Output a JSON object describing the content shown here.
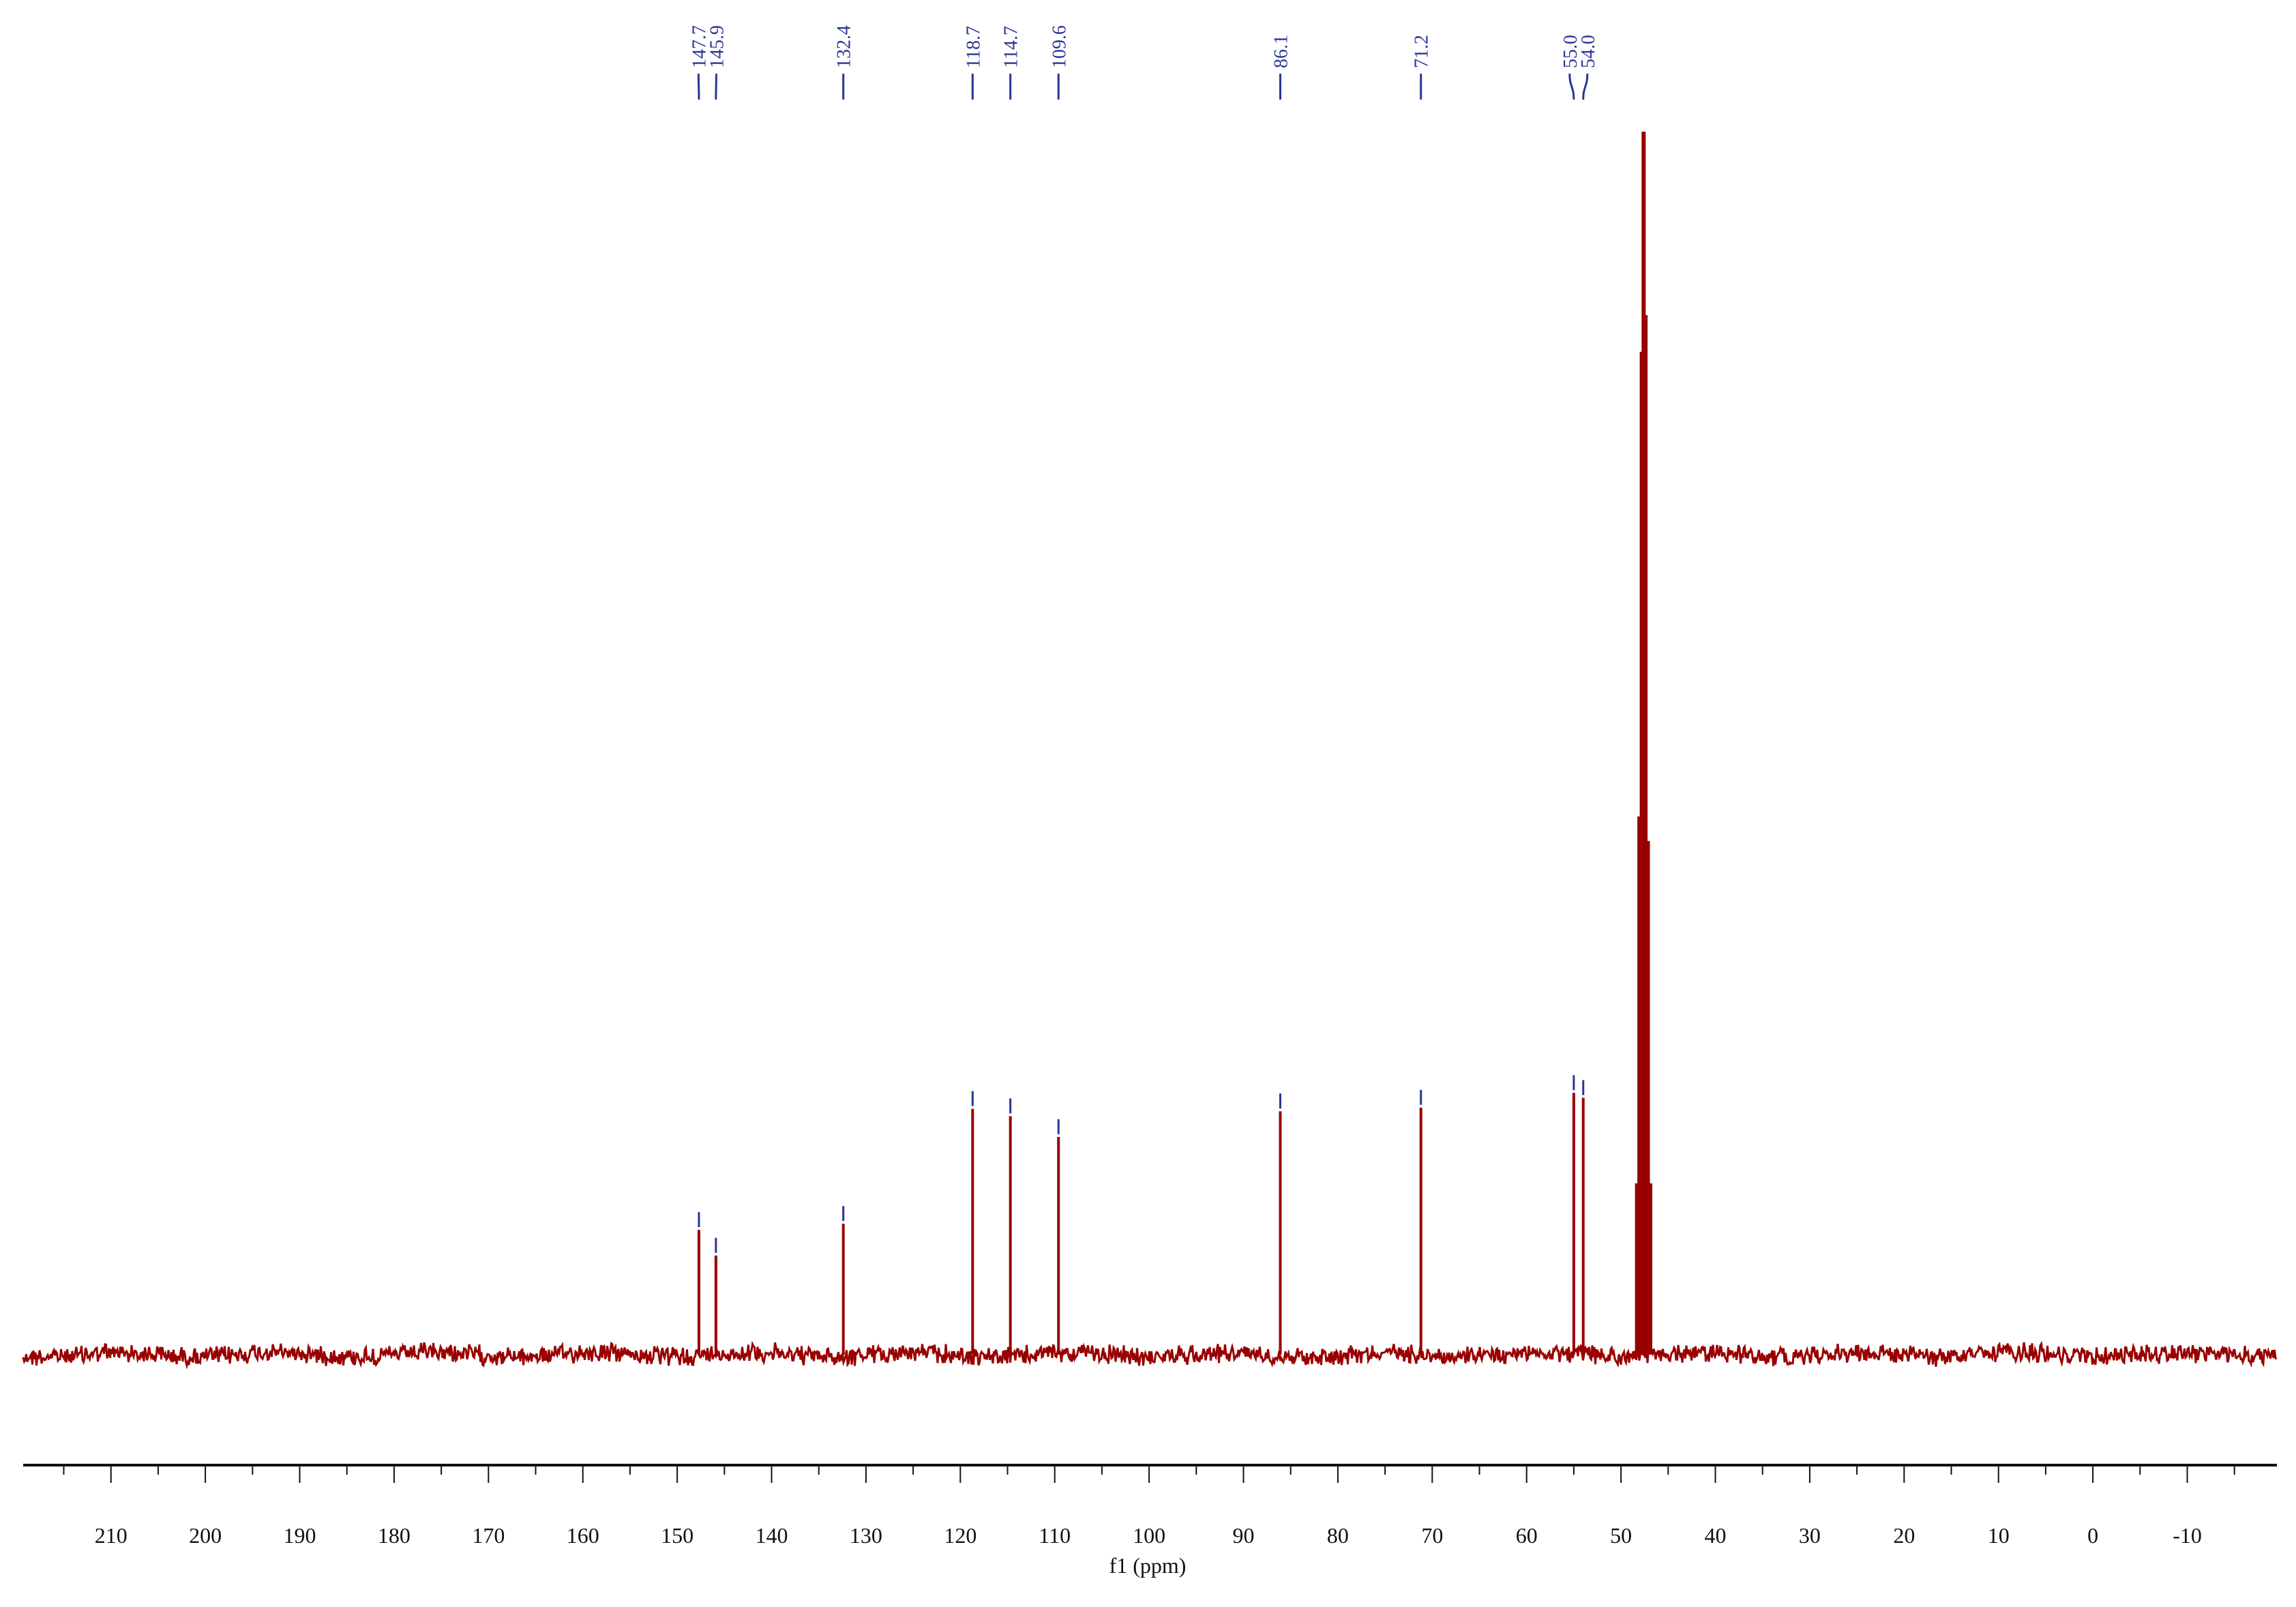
{
  "chart_data": {
    "type": "line",
    "title": "",
    "xlabel": "f1 (ppm)",
    "ylabel": "",
    "xlim": [
      219.3,
      -19.5
    ],
    "ylim": [
      0,
      1
    ],
    "x_reversed": true,
    "grid": false,
    "legend": "none",
    "xticks": [
      210,
      200,
      190,
      180,
      170,
      160,
      150,
      140,
      130,
      120,
      110,
      100,
      90,
      80,
      70,
      60,
      50,
      40,
      30,
      20,
      10,
      0,
      -10
    ],
    "xtick_labels": [
      "210",
      "200",
      "190",
      "180",
      "170",
      "160",
      "150",
      "140",
      "130",
      "120",
      "110",
      "100",
      "90",
      "80",
      "70",
      "60",
      "50",
      "40",
      "30",
      "20",
      "10",
      "0",
      "-10"
    ],
    "peaks": [
      {
        "ppm": 147.7,
        "label": "147.7",
        "intensity": 0.102
      },
      {
        "ppm": 145.9,
        "label": "145.9",
        "intensity": 0.081
      },
      {
        "ppm": 132.4,
        "label": "132.4",
        "intensity": 0.107
      },
      {
        "ppm": 118.7,
        "label": "118.7",
        "intensity": 0.201
      },
      {
        "ppm": 114.7,
        "label": "114.7",
        "intensity": 0.195
      },
      {
        "ppm": 109.6,
        "label": "109.6",
        "intensity": 0.178
      },
      {
        "ppm": 86.1,
        "label": "86.1",
        "intensity": 0.199
      },
      {
        "ppm": 71.2,
        "label": "71.2",
        "intensity": 0.202
      },
      {
        "ppm": 55.0,
        "label": "55.0",
        "intensity": 0.214
      },
      {
        "ppm": 54.0,
        "label": "54.0",
        "intensity": 0.21
      }
    ],
    "solvent_multiplet": [
      {
        "ppm": 48.3,
        "intensity": 0.14
      },
      {
        "ppm": 48.05,
        "intensity": 0.44
      },
      {
        "ppm": 47.8,
        "intensity": 0.82
      },
      {
        "ppm": 47.6,
        "intensity": 1.0
      },
      {
        "ppm": 47.4,
        "intensity": 0.85
      },
      {
        "ppm": 47.15,
        "intensity": 0.42
      },
      {
        "ppm": 46.9,
        "intensity": 0.14
      }
    ],
    "colors": {
      "spectrum": "#990000",
      "labels": "#2a3596",
      "axis": "#111111"
    }
  }
}
